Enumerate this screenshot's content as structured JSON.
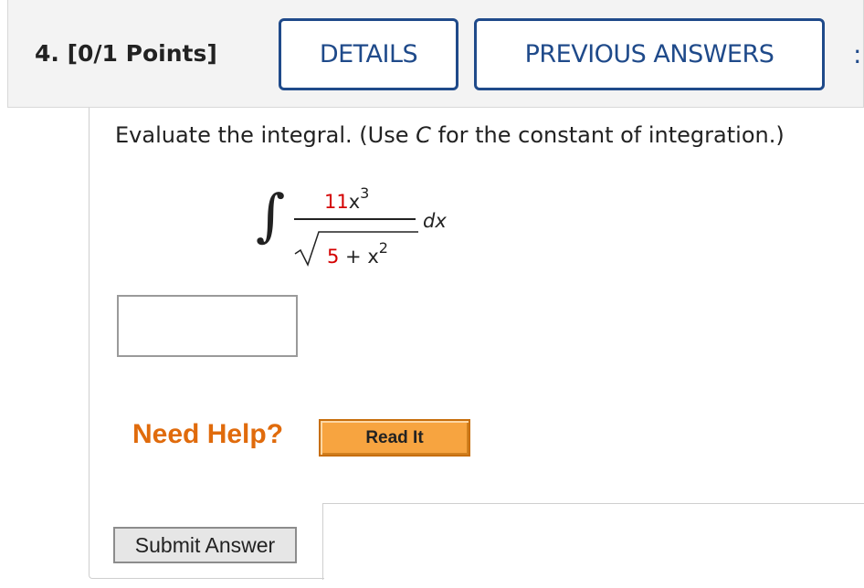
{
  "question": {
    "number_points": "4. [0/1 Points]",
    "details_label": "DETAILS",
    "previous_answers_label": "PREVIOUS ANSWERS"
  },
  "prompt": {
    "text_before": "Evaluate the integral. (Use ",
    "variable": "C",
    "text_after": " for the constant of integration.)"
  },
  "integral": {
    "symbol": "∫",
    "numerator_coef": "11",
    "numerator_var": "x",
    "numerator_exp": "3",
    "denominator_const": "5",
    "denominator_plus": " + x",
    "denominator_exp": "2",
    "differential": "dx",
    "highlight_color": "#d40000"
  },
  "answer": {
    "value": ""
  },
  "help": {
    "label": "Need Help?",
    "read_it_label": "Read It"
  },
  "submit": {
    "label": "Submit Answer"
  },
  "colors": {
    "accent": "#1f4a8a",
    "help_orange": "#e06b0c",
    "read_it_bg": "#f7a440"
  }
}
